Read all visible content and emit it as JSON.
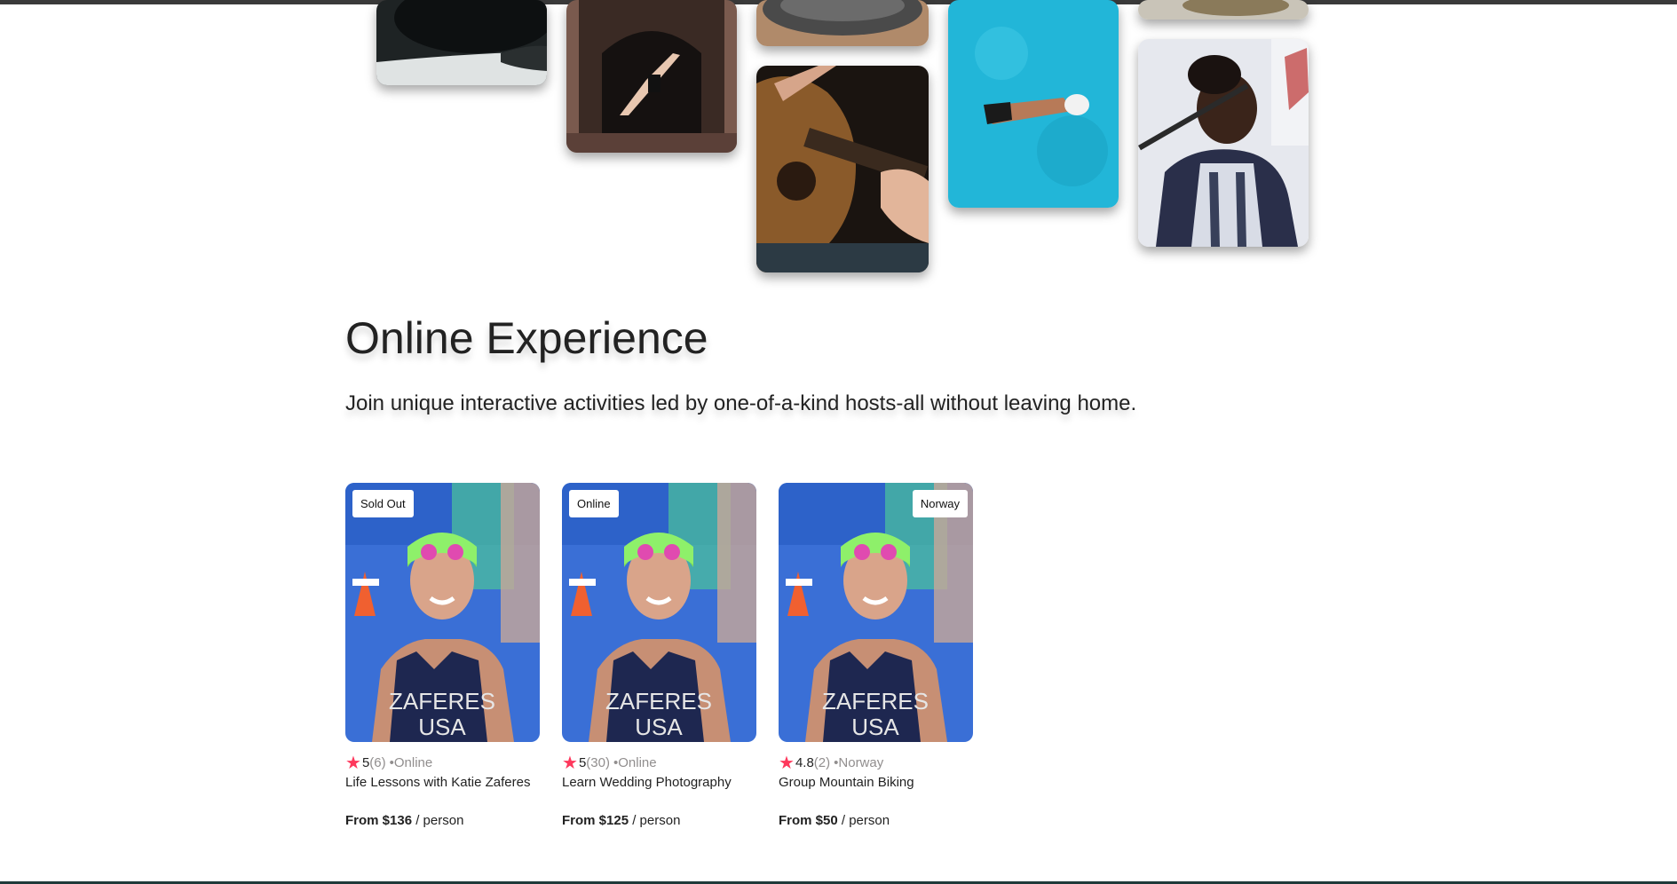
{
  "collage": {
    "tiles": [
      {
        "name": "coffee-cup-photo"
      },
      {
        "name": "dancer-photo"
      },
      {
        "name": "bowl-photo"
      },
      {
        "name": "guitar-photo"
      },
      {
        "name": "swimmer-photo"
      },
      {
        "name": "food-photo"
      },
      {
        "name": "singer-photo"
      }
    ]
  },
  "section": {
    "title": "Online Experience",
    "subtitle": "Join unique interactive activities led by one-of-a-kind hosts-all without leaving home."
  },
  "cards": [
    {
      "badge": "Sold Out",
      "star": "★",
      "rating": "5",
      "reviews": "(6)",
      "location": "•Online",
      "title": "Life Lessons with Katie Zaferes",
      "price": "From $136",
      "unit": "/ person"
    },
    {
      "badge": "Online",
      "star": "★",
      "rating": "5",
      "reviews": "(30)",
      "location": "•Online",
      "title": "Learn Wedding Photography",
      "price": "From $125",
      "unit": "/ person"
    },
    {
      "badge": "Norway",
      "star": "★",
      "rating": "4.8",
      "reviews": "(2)",
      "location": "•Norway",
      "title": "Group Mountain Biking",
      "price": "From $50",
      "unit": "/ person"
    }
  ],
  "athlete_photo": {
    "shirt_line1": "ZAFERES",
    "shirt_line2": "USA"
  },
  "colors": {
    "star": "#fe385c",
    "muted": "#918e8e",
    "text": "#222222"
  }
}
